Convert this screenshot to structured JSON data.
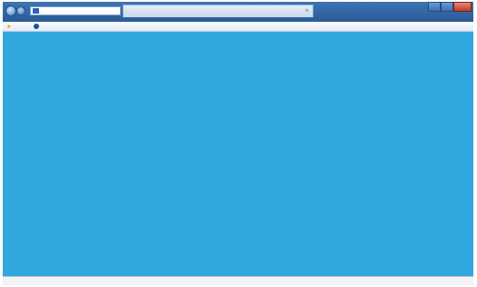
{
  "browser": {
    "address": {
      "url": ""
    },
    "tab": {
      "title": ""
    },
    "caption": {
      "minimize": "",
      "maximize": "",
      "close": ""
    }
  },
  "favorites": {
    "label": "",
    "link": ""
  },
  "command_bar": {
    "items": [
      "",
      "",
      "",
      "",
      ""
    ]
  },
  "content": {
    "background": "#31a8dd",
    "message_line1": "",
    "message_line2": ""
  },
  "status": {
    "left": "",
    "zone": "",
    "zoom": ""
  }
}
